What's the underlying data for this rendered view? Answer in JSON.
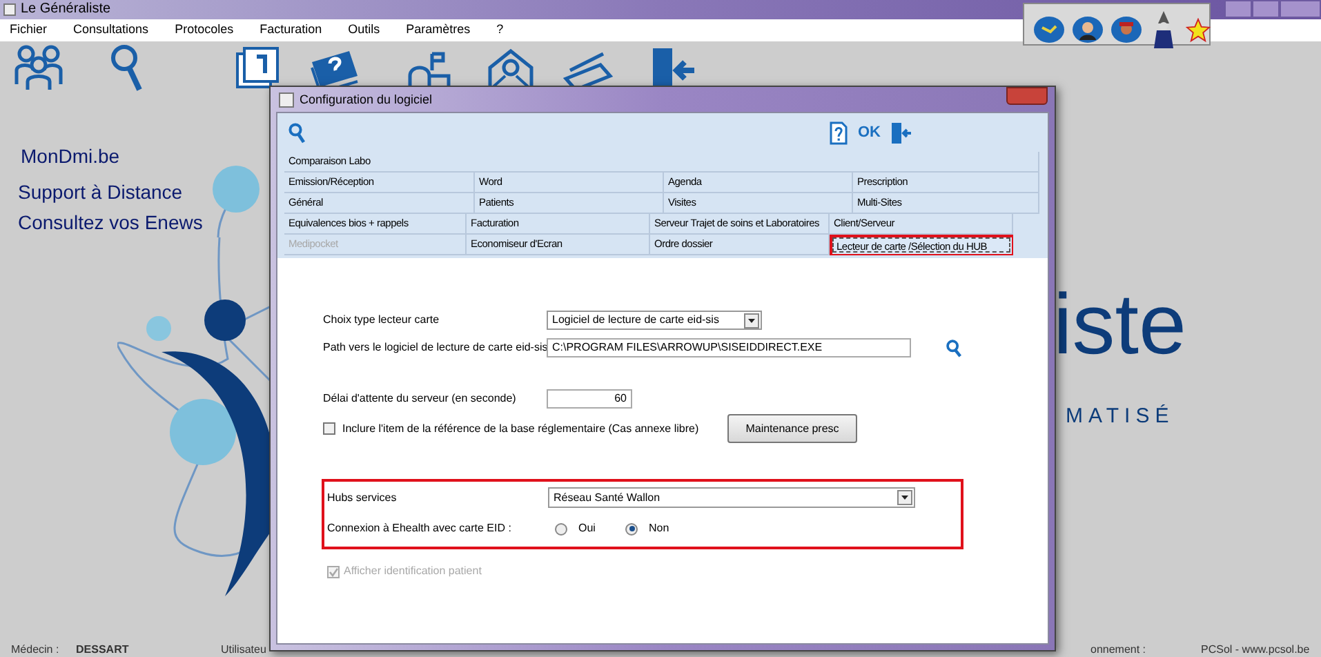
{
  "window": {
    "title": "Le Généraliste"
  },
  "menu": [
    "Fichier",
    "Consultations",
    "Protocoles",
    "Facturation",
    "Outils",
    "Paramètres",
    "?"
  ],
  "sidebar_links": [
    "MonDmi.be",
    "Support à Distance",
    "Consultez vos Enews"
  ],
  "logo": {
    "word": "iste",
    "tagline": "MATISÉ"
  },
  "dialog": {
    "title": "Configuration du logiciel",
    "ok": "OK",
    "tab_rows": [
      [
        {
          "label": "Comparaison Labo",
          "selected": false,
          "disabled": false
        }
      ],
      [
        {
          "label": "Emission/Réception",
          "selected": false,
          "disabled": false
        },
        {
          "label": "Word",
          "selected": false,
          "disabled": false
        },
        {
          "label": "Agenda",
          "selected": false,
          "disabled": false
        },
        {
          "label": "Prescription",
          "selected": false,
          "disabled": false
        }
      ],
      [
        {
          "label": "Général",
          "selected": false,
          "disabled": false
        },
        {
          "label": "Patients",
          "selected": false,
          "disabled": false
        },
        {
          "label": "Visites",
          "selected": false,
          "disabled": false
        },
        {
          "label": "Multi-Sites",
          "selected": false,
          "disabled": false
        }
      ],
      [
        {
          "label": "Equivalences bios + rappels",
          "selected": false,
          "disabled": false
        },
        {
          "label": "Facturation",
          "selected": false,
          "disabled": false
        },
        {
          "label": "Serveur Trajet de soins et Laboratoires",
          "selected": false,
          "disabled": false
        },
        {
          "label": "Client/Serveur",
          "selected": false,
          "disabled": false
        }
      ],
      [
        {
          "label": "Medipocket",
          "selected": false,
          "disabled": true
        },
        {
          "label": "Economiseur d'Ecran",
          "selected": false,
          "disabled": false
        },
        {
          "label": "Ordre dossier",
          "selected": false,
          "disabled": false
        },
        {
          "label": "Lecteur de carte /Sélection du HUB",
          "selected": true,
          "disabled": false
        }
      ]
    ],
    "reader_type": {
      "label": "Choix type lecteur carte",
      "value": "Logiciel de lecture de carte eid-sis"
    },
    "reader_path": {
      "label": "Path vers le logiciel de lecture de carte eid-sis",
      "value": "C:\\PROGRAM FILES\\ARROWUP\\SISEIDDIRECT.EXE"
    },
    "server_delay": {
      "label": "Délai d'attente du serveur (en seconde)",
      "value": "60"
    },
    "include_item": {
      "label": "Inclure l'item de la référence de la base réglementaire (Cas annexe libre)",
      "checked": false
    },
    "maintenance_button": "Maintenance presc",
    "hubs": {
      "label": "Hubs services",
      "value": "Réseau Santé Wallon"
    },
    "ehealth": {
      "label": "Connexion à Ehealth avec carte EID :",
      "options": [
        {
          "label": "Oui",
          "selected": false
        },
        {
          "label": "Non",
          "selected": true
        }
      ]
    },
    "show_patient_id": {
      "label": "Afficher identification patient",
      "checked": true,
      "disabled": true
    }
  },
  "status_bar": {
    "doctor_label": "Médecin :",
    "doctor": "DESSART",
    "user_label": "Utilisateu",
    "subscription_label": "onnement :",
    "site": "PCSol - www.pcsol.be"
  }
}
